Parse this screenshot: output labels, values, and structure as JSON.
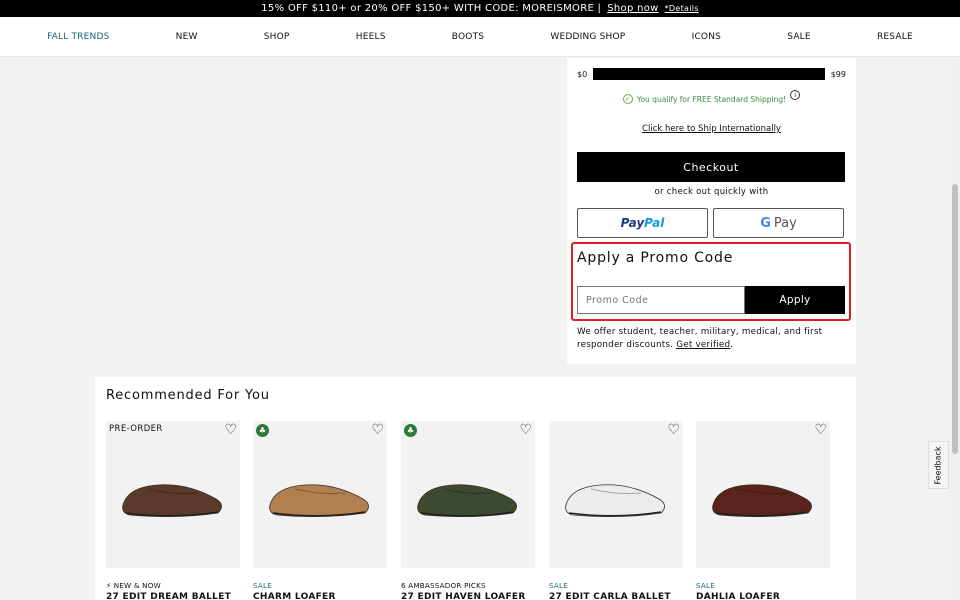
{
  "promo_bar": {
    "text": "15% OFF $110+ or 20% OFF $150+ WITH CODE: MOREISMORE |",
    "link": "Shop now",
    "details": "*Details"
  },
  "nav": {
    "items": [
      "FALL TRENDS",
      "NEW",
      "SHOP",
      "HEELS",
      "BOOTS",
      "WEDDING SHOP",
      "ICONS",
      "SALE",
      "RESALE"
    ],
    "active_color": "#1a5f7a"
  },
  "shipping": {
    "min_label": "$0",
    "max_label": "$99",
    "progress_fraction": 1.0,
    "qualify_text": "You qualify for FREE Standard Shipping!",
    "intl_link": "Click here to Ship Internationally"
  },
  "checkout": {
    "label": "Checkout",
    "quick_text": "or check out quickly with",
    "paypal_pay": "Pay",
    "paypal_pal": "Pal",
    "gpay_g": "G",
    "gpay_label": "Pay"
  },
  "promo": {
    "title": "Apply a Promo Code",
    "placeholder": "Promo Code",
    "apply_label": "Apply",
    "highlight_color": "#e31b23"
  },
  "discount": {
    "text": "We offer student, teacher, military, medical, and first responder discounts.",
    "link": "Get verified",
    "end": "."
  },
  "recommend": {
    "title": "Recommended For You",
    "products": [
      {
        "badge": "PRE-ORDER",
        "tag": "⚡ NEW & NOW",
        "name": "27 EDIT DREAM BALLET",
        "shoe_color": "#5a3a2a",
        "sale": false,
        "eco": false
      },
      {
        "badge": "",
        "tag": "SALE",
        "name": "CHARM LOAFER",
        "shoe_color": "#b0804f",
        "sale": true,
        "eco": true
      },
      {
        "badge": "",
        "tag": "6 AMBASSADOR PICKS",
        "name": "27 EDIT HAVEN LOAFER",
        "shoe_color": "#3d4a32",
        "sale": false,
        "eco": true
      },
      {
        "badge": "",
        "tag": "SALE",
        "name": "27 EDIT CARLA BALLET",
        "shoe_color": "#ececec",
        "sale": true,
        "eco": false
      },
      {
        "badge": "",
        "tag": "SALE",
        "name": "DAHLIA LOAFER",
        "shoe_color": "#5a231c",
        "sale": true,
        "eco": false
      }
    ]
  },
  "feedback": "Feedback"
}
